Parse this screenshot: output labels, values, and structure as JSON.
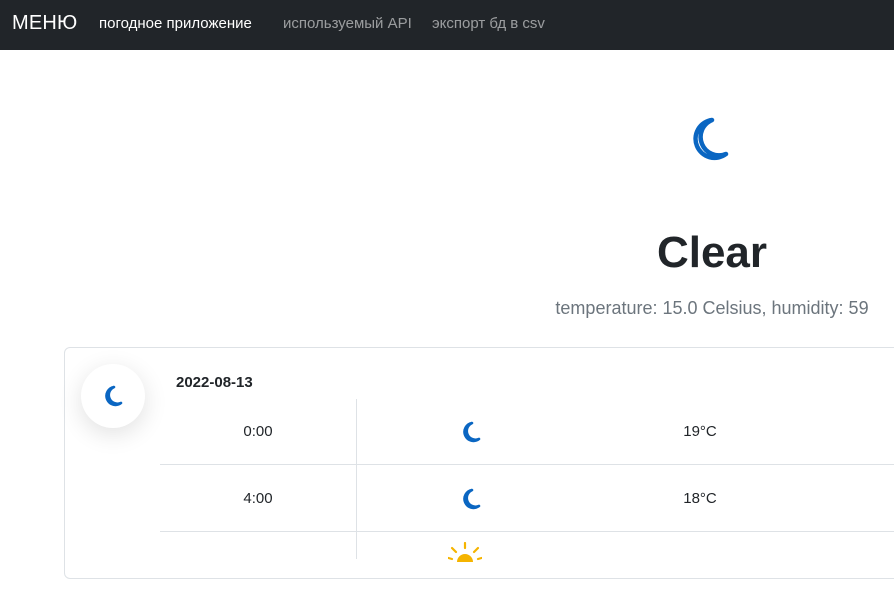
{
  "navbar": {
    "brand": "МЕНЮ",
    "links": [
      {
        "label": "погодное приложение",
        "active": true
      },
      {
        "label": "используемый API",
        "active": false
      },
      {
        "label": "экспорт бд в csv",
        "active": false
      }
    ],
    "background": "#212529"
  },
  "current": {
    "icon": "moon-icon",
    "condition": "Clear",
    "details": "temperature: 15.0 Celsius, humidity: 59"
  },
  "forecast": {
    "date": "2022-08-13",
    "badge_icon": "moon-icon",
    "rows": [
      {
        "time": "0:00",
        "icon": "moon-icon",
        "temp": "19°C"
      },
      {
        "time": "4:00",
        "icon": "moon-icon",
        "temp": "18°C"
      },
      {
        "time": "",
        "icon": "sun-icon",
        "temp": ""
      }
    ]
  },
  "colors": {
    "accent": "#0d6efd",
    "icon_blue": "#0a66c2",
    "sun": "#f5b400",
    "muted_text": "#6c757d"
  }
}
